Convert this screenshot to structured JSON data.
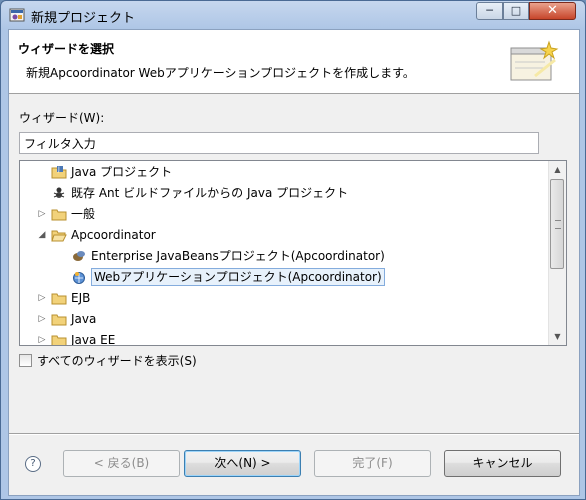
{
  "window": {
    "title": "新規プロジェクト",
    "controls": {
      "minimize": "─",
      "maximize": "□",
      "close": "✕"
    }
  },
  "header": {
    "title": "ウィザードを選択",
    "description": "新規Apcoordinator Webアプリケーションプロジェクトを作成します。",
    "banner_icon": "wizard-banner-icon"
  },
  "wizard_section": {
    "label": "ウィザード(W):",
    "filter_value": "フィルタ入力"
  },
  "tree": {
    "items": [
      {
        "label": "Java プロジェクト",
        "depth": 0,
        "toggle": "",
        "icon": "java-project-icon"
      },
      {
        "label": "既存 Ant ビルドファイルからの Java プロジェクト",
        "depth": 0,
        "toggle": "",
        "icon": "ant-icon"
      },
      {
        "label": "一般",
        "depth": 0,
        "toggle": "▷",
        "icon": "folder-icon"
      },
      {
        "label": "Apcoordinator",
        "depth": 0,
        "toggle": "◢",
        "icon": "folder-open-icon"
      },
      {
        "label": "Enterprise JavaBeansプロジェクト(Apcoordinator)",
        "depth": 1,
        "toggle": "",
        "icon": "ejb-project-icon"
      },
      {
        "label": "Webアプリケーションプロジェクト(Apcoordinator)",
        "depth": 1,
        "toggle": "",
        "icon": "web-project-icon",
        "selected": true
      },
      {
        "label": "EJB",
        "depth": 0,
        "toggle": "▷",
        "icon": "folder-icon"
      },
      {
        "label": "Java",
        "depth": 0,
        "toggle": "▷",
        "icon": "folder-icon"
      },
      {
        "label": "Java EE",
        "depth": 0,
        "toggle": "▷",
        "icon": "folder-icon"
      }
    ]
  },
  "show_all": {
    "label": "すべてのウィザードを表示(S)",
    "checked": false
  },
  "buttons": {
    "help": "?",
    "back": "< 戻る(B)",
    "next": "次へ(N) >",
    "finish": "完了(F)",
    "cancel": "キャンセル"
  }
}
